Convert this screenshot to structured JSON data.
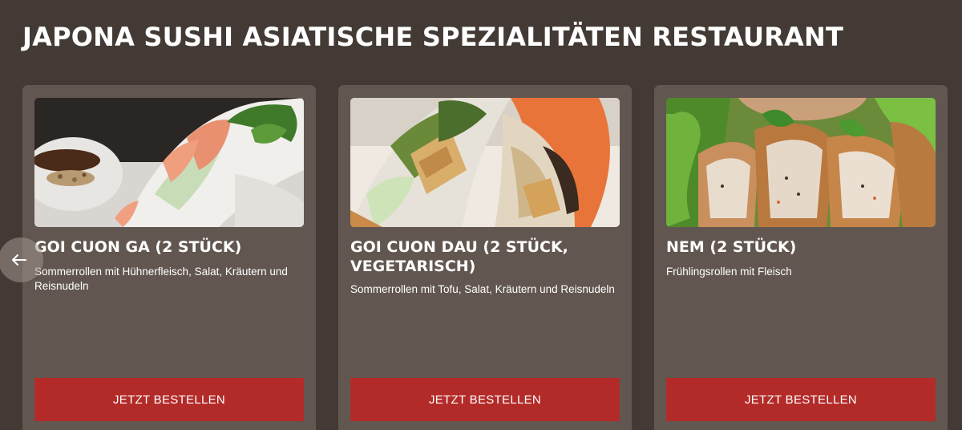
{
  "page": {
    "title": "JAPONA SUSHI ASIATISCHE SPEZIALITÄTEN RESTAURANT"
  },
  "carousel": {
    "prev_icon": "arrow-left-icon"
  },
  "cards": [
    {
      "title": "GOI CUON GA (2 STÜCK)",
      "description": "Sommerrollen mit Hühnerfleisch, Salat, Kräutern und Reisnudeln",
      "button_label": "JETZT BESTELLEN"
    },
    {
      "title": "GOI CUON DAU (2 STÜCK, VEGETARISCH)",
      "description": "Sommerrollen mit Tofu, Salat, Kräutern und Reisnudeln",
      "button_label": "JETZT BESTELLEN"
    },
    {
      "title": "NEM (2 STÜCK)",
      "description": "Frühlingsrollen mit Fleisch",
      "button_label": "JETZT BESTELLEN"
    }
  ],
  "colors": {
    "background": "#433a36",
    "card": "#625750",
    "button": "#b32b29",
    "text": "#ffffff"
  }
}
